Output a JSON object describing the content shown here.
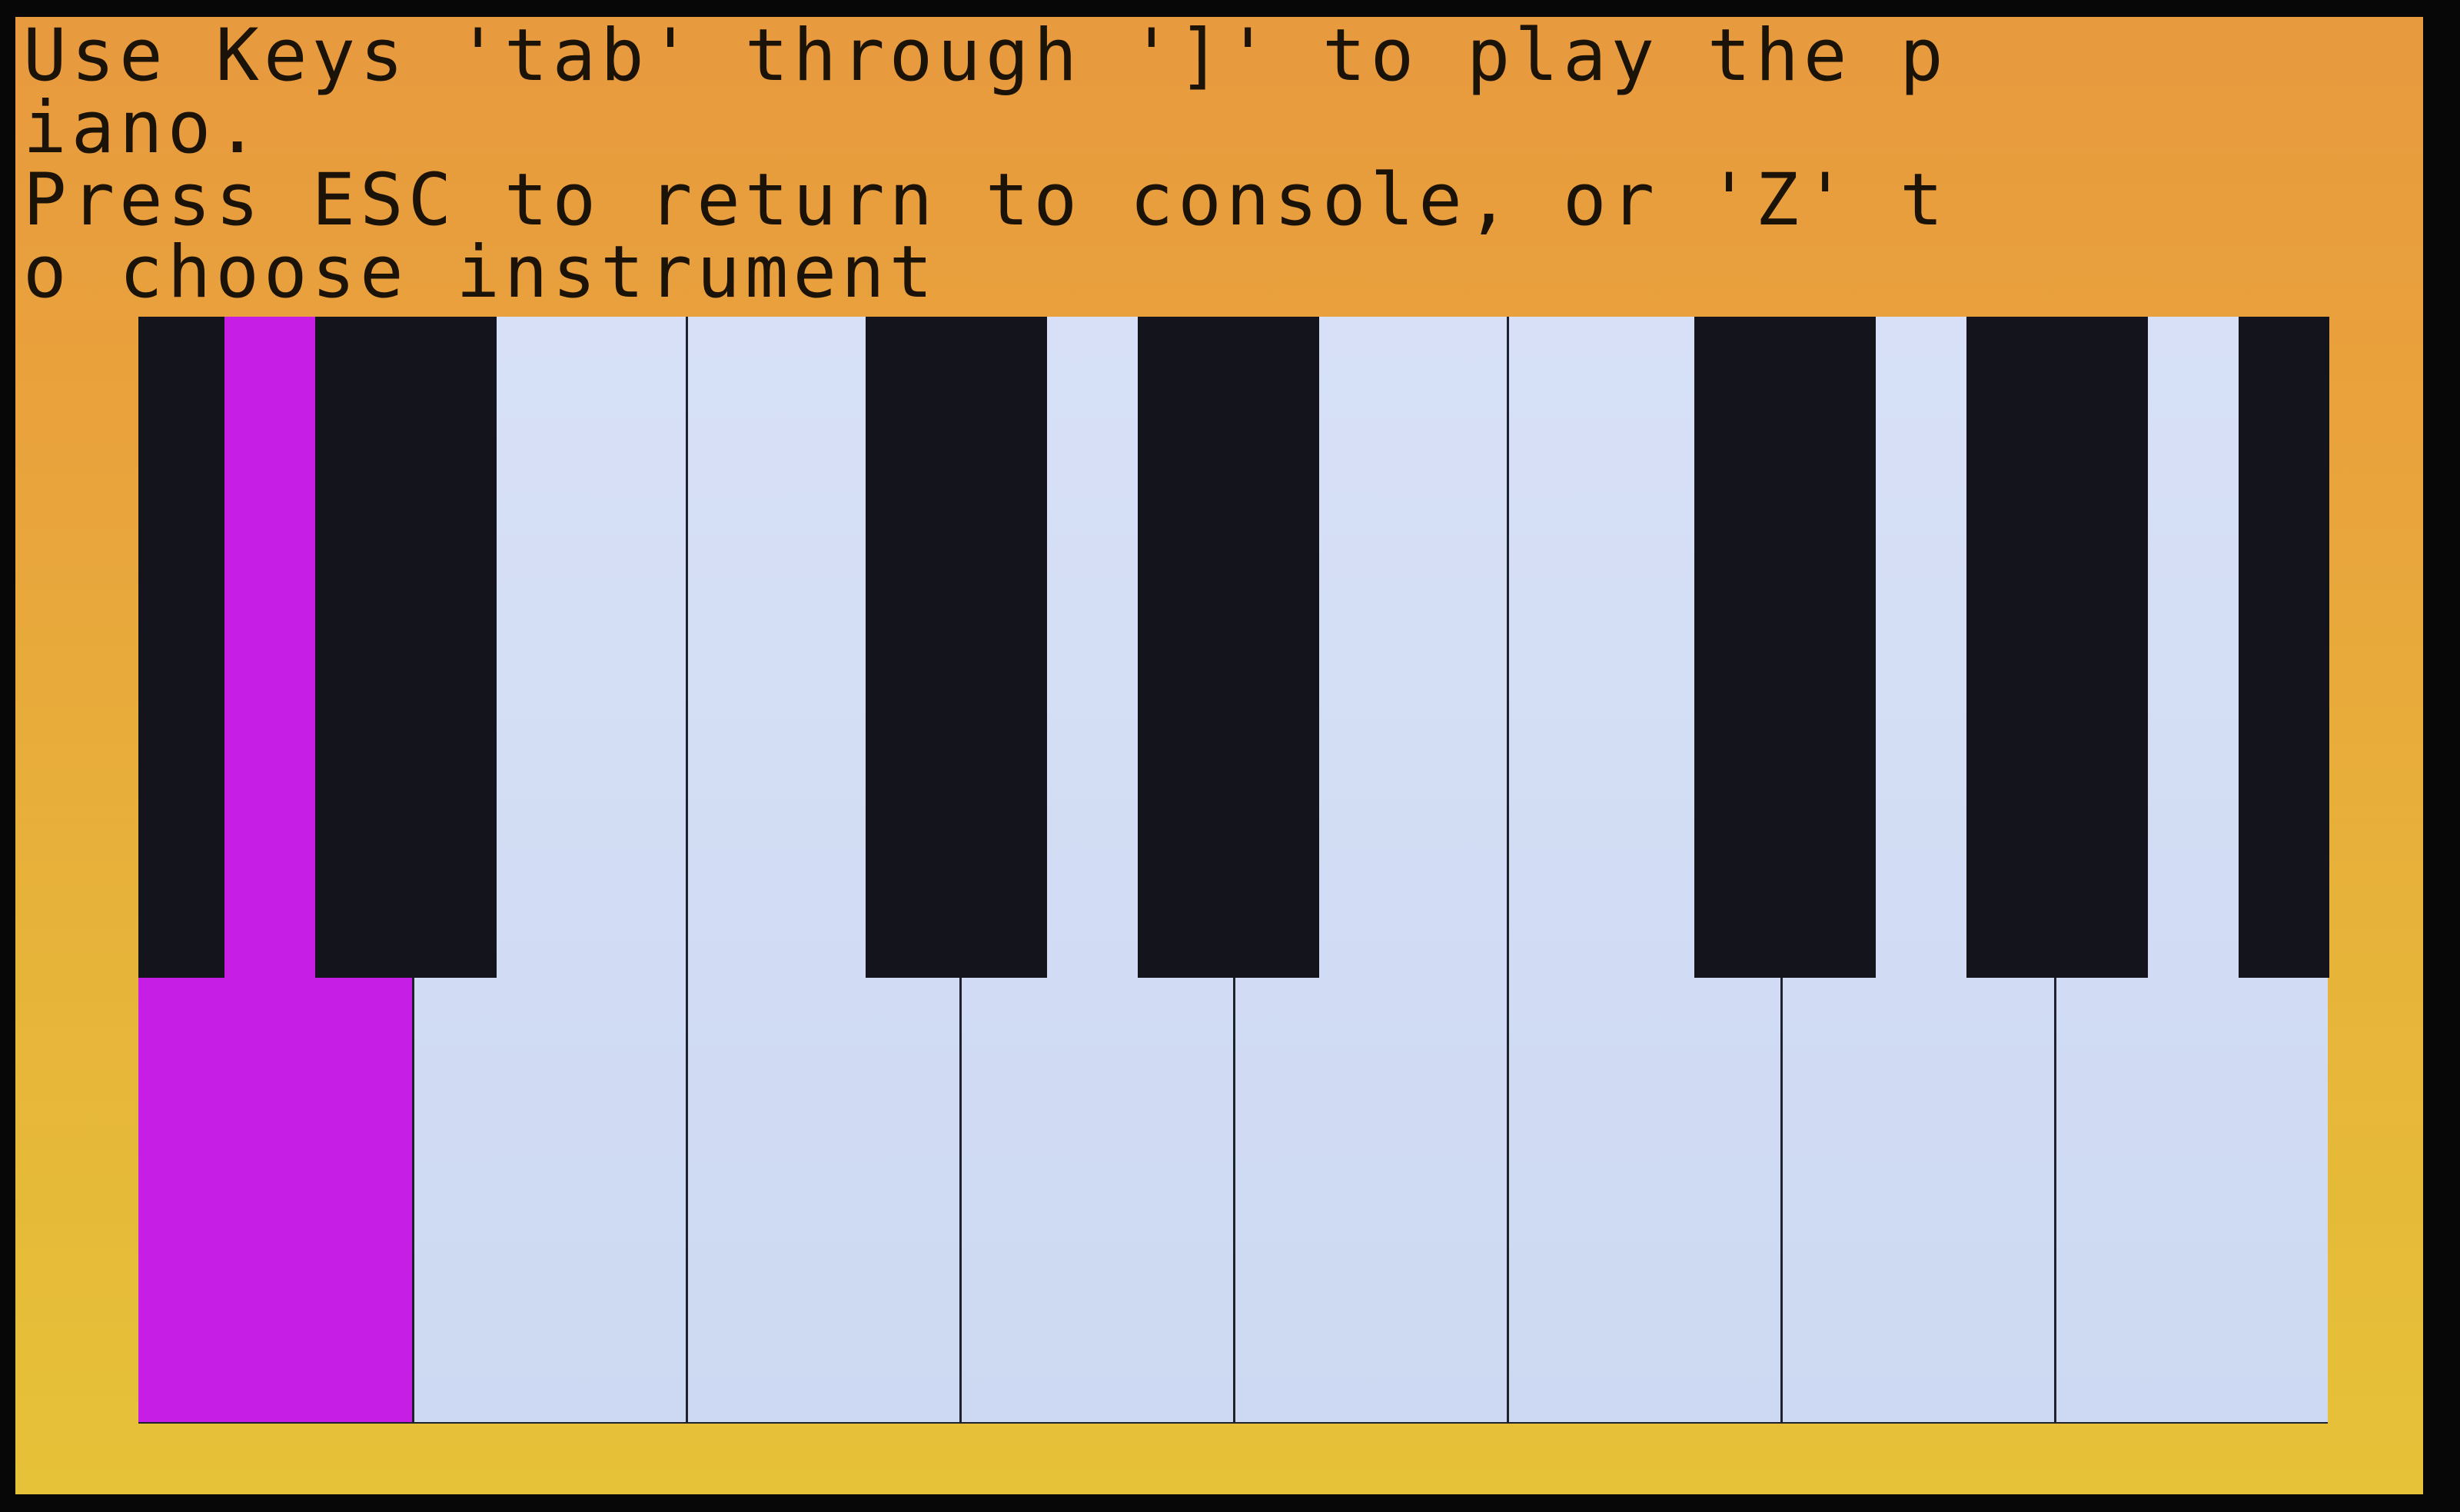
{
  "instructions": {
    "line1": "Use Keys 'tab' through ']' to play the p",
    "line2": "iano.",
    "line3": "Press ESC to return to console, or 'Z' t",
    "line4": "o choose instrument"
  },
  "colors": {
    "background_top": "#e89a3e",
    "background_bottom": "#e6c238",
    "white_key": "#d7e0f6",
    "black_key": "#13141c",
    "pressed_key": "#c71ee6",
    "text": "#1b1208"
  },
  "keyboard": {
    "white_keys": 8,
    "black_keys": 6,
    "pressed_key": "white-key-1"
  }
}
